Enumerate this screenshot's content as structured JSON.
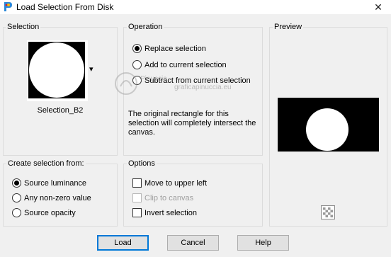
{
  "window": {
    "title": "Load Selection From Disk",
    "close_glyph": "✕"
  },
  "selection_group": {
    "title": "Selection",
    "file_name": "Selection_B2",
    "dropdown_glyph": "▾"
  },
  "operation_group": {
    "title": "Operation",
    "options": [
      {
        "label": "Replace selection",
        "checked": true
      },
      {
        "label": "Add to current selection",
        "checked": false
      },
      {
        "label": "Subtract from current selection",
        "checked": false
      }
    ],
    "description": "The original rectangle for this selection will completely intersect the canvas."
  },
  "preview_group": {
    "title": "Preview"
  },
  "create_group": {
    "title": "Create selection from:",
    "options": [
      {
        "label": "Source luminance",
        "checked": true
      },
      {
        "label": "Any non-zero value",
        "checked": false
      },
      {
        "label": "Source opacity",
        "checked": false
      }
    ]
  },
  "options_group": {
    "title": "Options",
    "items": [
      {
        "label": "Move to upper left",
        "checked": false,
        "enabled": true
      },
      {
        "label": "Clip to canvas",
        "checked": false,
        "enabled": false
      },
      {
        "label": "Invert selection",
        "checked": false,
        "enabled": true
      }
    ]
  },
  "buttons": {
    "load": "Load",
    "cancel": "Cancel",
    "help": "Help"
  },
  "watermark": {
    "text": "Pinuccia",
    "subtext": "graficapinuccia.eu"
  },
  "colors": {
    "accent": "#0078d7",
    "preview_bg": "#000000",
    "shape": "#ffffff"
  }
}
